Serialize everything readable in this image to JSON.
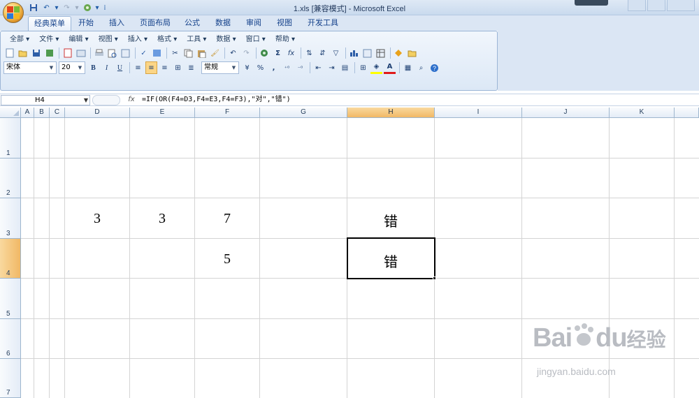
{
  "window": {
    "title": "1.xls  [兼容模式] - Microsoft Excel"
  },
  "ribbon_tabs": [
    "经典菜单",
    "开始",
    "插入",
    "页面布局",
    "公式",
    "数据",
    "审阅",
    "视图",
    "开发工具"
  ],
  "active_tab": "经典菜单",
  "menus": [
    "全部",
    "文件",
    "编辑",
    "视图",
    "插入",
    "格式",
    "工具",
    "数据",
    "窗口",
    "帮助"
  ],
  "toolbar": {
    "font_name": "宋体",
    "font_size": "20",
    "number_format": "常规",
    "bold": "B",
    "italic": "I",
    "underline": "U",
    "sum": "Σ",
    "fx": "fx",
    "percent": "%",
    "comma": ","
  },
  "formula_bar": {
    "name_box": "H4",
    "fx_label": "fx",
    "formula": "=IF(OR(F4=D3,F4=E3,F4=F3),\"对\",\"错\")"
  },
  "columns": [
    "A",
    "B",
    "C",
    "D",
    "E",
    "F",
    "G",
    "H",
    "I",
    "J",
    "K"
  ],
  "rows": [
    "1",
    "2",
    "3",
    "4",
    "5",
    "6",
    "7"
  ],
  "selected_cell": "H4",
  "cells": {
    "D3": "3",
    "E3": "3",
    "F3": "7",
    "H3": "错",
    "F4": "5",
    "H4": "错"
  },
  "watermark": {
    "brand": "Bai",
    "brand2": "du",
    "cn": "经验",
    "url": "jingyan.baidu.com"
  }
}
